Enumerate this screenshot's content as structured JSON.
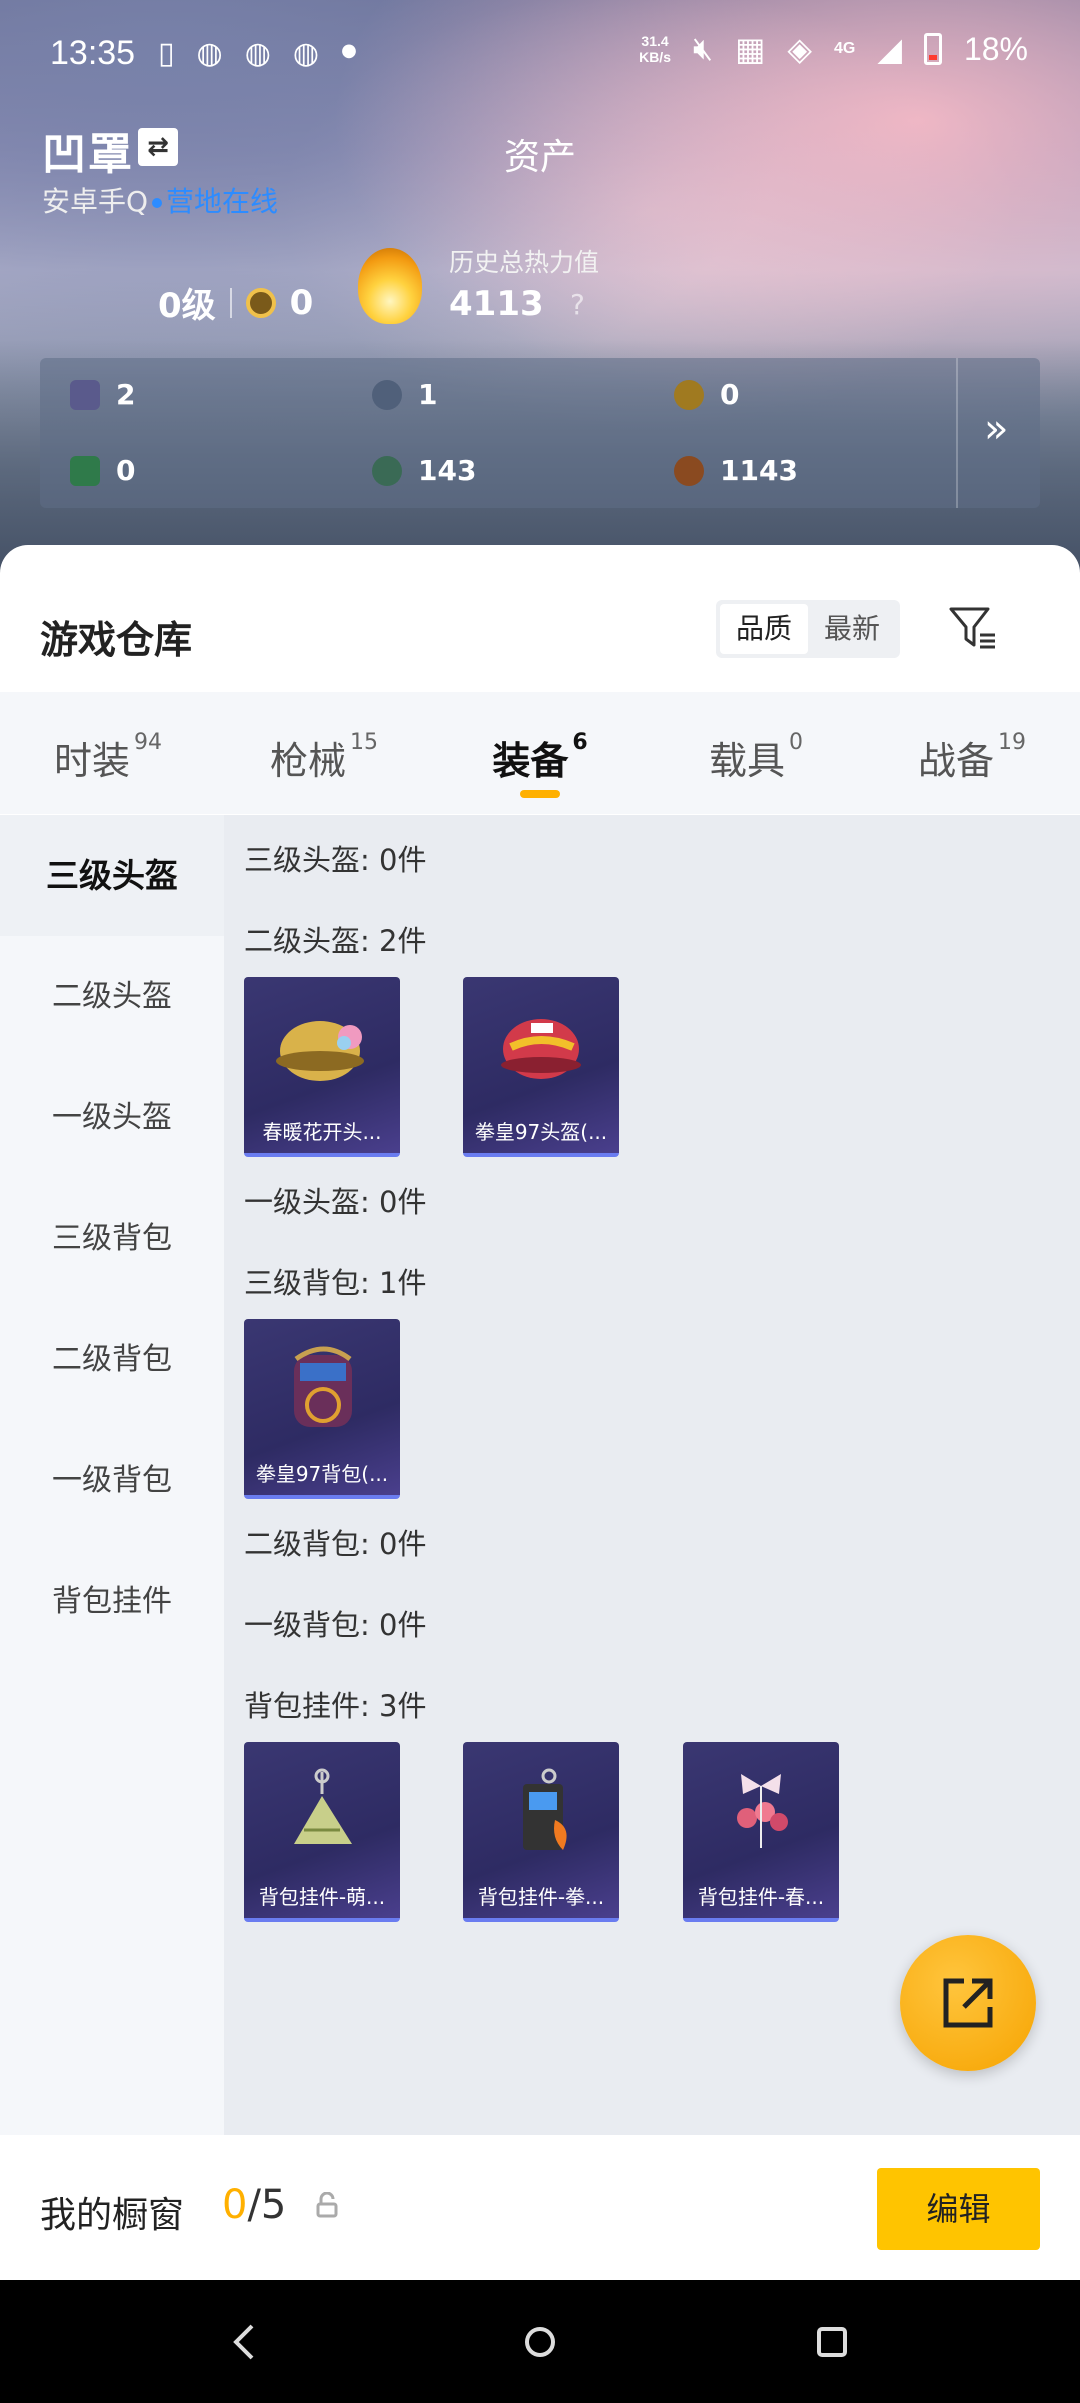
{
  "status_bar": {
    "time": "13:35",
    "net_speed_value": "31.4",
    "net_speed_unit": "KB/s",
    "network": "4G",
    "battery": "18%"
  },
  "header": {
    "title": "资产",
    "username": "凹罩",
    "platform": "安卓手Q",
    "status": "营地在线",
    "level": "0级",
    "medal_count": "0",
    "heat_label": "历史总热力值",
    "heat_value": "4113",
    "heat_help": "?"
  },
  "currencies": [
    {
      "icon": "card-icon",
      "value": "2",
      "color": "#5a5a8c"
    },
    {
      "icon": "silver-coin-icon",
      "value": "1",
      "color": "#50607a"
    },
    {
      "icon": "gold-coin-icon",
      "value": "0",
      "color": "#a07a20"
    },
    {
      "icon": "green-ticket-icon",
      "value": "0",
      "color": "#2f7a4a"
    },
    {
      "icon": "green-orb-icon",
      "value": "143",
      "color": "#3a6a55"
    },
    {
      "icon": "bronze-coin-icon",
      "value": "1143",
      "color": "#8a4a20"
    }
  ],
  "warehouse": {
    "title": "游戏仓库",
    "sort_options": [
      "品质",
      "最新"
    ],
    "active_sort": "品质"
  },
  "tabs": [
    {
      "label": "时装",
      "count": "94"
    },
    {
      "label": "枪械",
      "count": "15"
    },
    {
      "label": "装备",
      "count": "6"
    },
    {
      "label": "载具",
      "count": "0"
    },
    {
      "label": "战备",
      "count": "19"
    }
  ],
  "sidebar": [
    "三级头盔",
    "二级头盔",
    "一级头盔",
    "三级背包",
    "二级背包",
    "一级背包",
    "背包挂件"
  ],
  "groups": [
    {
      "title": "三级头盔: 0件",
      "items": []
    },
    {
      "title": "二级头盔: 2件",
      "items": [
        "春暖花开头...",
        "拳皇97头盔(..."
      ]
    },
    {
      "title": "一级头盔: 0件",
      "items": []
    },
    {
      "title": "三级背包: 1件",
      "items": [
        "拳皇97背包(..."
      ]
    },
    {
      "title": "二级背包: 0件",
      "items": []
    },
    {
      "title": "一级背包: 0件",
      "items": []
    },
    {
      "title": "背包挂件: 3件",
      "items": [
        "背包挂件-萌...",
        "背包挂件-拳...",
        "背包挂件-春..."
      ]
    }
  ],
  "showcase": {
    "label": "我的橱窗",
    "current": "0",
    "total": "/5",
    "edit_label": "编辑"
  },
  "colors": {
    "accent": "#ffb000",
    "online": "#2d8cff",
    "card_bg": "#2e2b63"
  }
}
